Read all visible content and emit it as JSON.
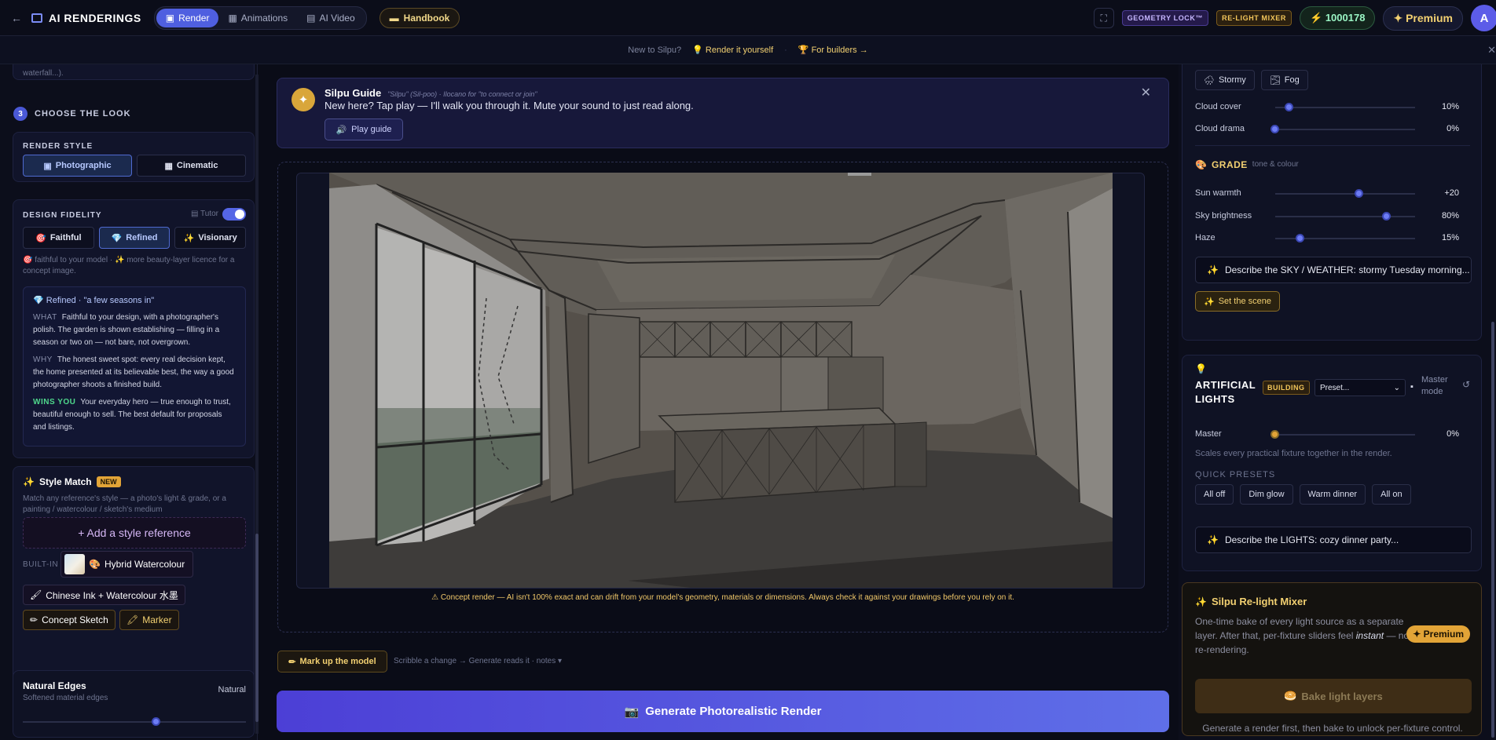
{
  "topbar": {
    "back_icon": "←",
    "title": "AI RENDERINGS",
    "modes": [
      {
        "label": "Render",
        "icon": "▣",
        "active": true
      },
      {
        "label": "Animations",
        "icon": "▦",
        "active": false
      },
      {
        "label": "AI Video",
        "icon": "▤",
        "active": false
      }
    ],
    "handbook": "Handbook",
    "expand_icon": "⛶",
    "geometry_lock": "GEOMETRY LOCK™",
    "relight_mixer": "RE-LIGHT MIXER",
    "credits": "1000178",
    "credits_icon": "⚡",
    "premium": "Premium",
    "premium_icon": "✦",
    "avatar": "A"
  },
  "subbar": {
    "new_to": "New to Silpu?",
    "render_it": "Render it yourself",
    "builders": "For builders →",
    "sep": "·",
    "close": "✕"
  },
  "left": {
    "truncated": "waterfall...).",
    "step_number": "3",
    "step_title": "CHOOSE THE LOOK",
    "render_style_label": "RENDER STYLE",
    "render_styles": [
      "Photographic",
      "Cinematic"
    ],
    "fidelity_label": "DESIGN FIDELITY",
    "tutor_label": "Tutor",
    "fidelity_options": [
      "Faithful",
      "Refined",
      "Visionary"
    ],
    "fidelity_hint_a": "faithful to your model ·",
    "fidelity_hint_b": "more beauty-layer licence for a concept image.",
    "info": {
      "title": "Refined · \"a few seasons in\"",
      "what_key": "WHAT",
      "what": "Faithful to your design, with a photographer's polish. The garden is shown establishing — filling in a season or two on — not bare, not overgrown.",
      "why_key": "WHY",
      "why": "The honest sweet spot: every real decision kept, the home presented at its believable best, the way a good photographer shoots a finished build.",
      "wins_key": "WINS YOU",
      "wins": "Your everyday hero — true enough to trust, beautiful enough to sell. The best default for proposals and listings."
    },
    "style_match": {
      "title": "Style Match",
      "badge": "NEW",
      "desc": "Match any reference's style — a photo's light & grade, or a painting / watercolour / sketch's medium",
      "add": "+ Add a style reference",
      "built_in": "BUILT-IN",
      "chips": [
        "Hybrid Watercolour",
        "Chinese Ink + Watercolour 水墨",
        "Concept Sketch",
        "Marker"
      ]
    },
    "natural_edges": {
      "title": "Natural Edges",
      "sub": "Softened material edges",
      "value": "Natural",
      "level": 0.6
    }
  },
  "guide": {
    "title": "Silpu Guide",
    "subtitle": "\"Silpu\" (Sil-poo) · Ilocano for \"to connect or join\"",
    "text": "New here? Tap play — I'll walk you through it. Mute your sound to just read along.",
    "play": "Play guide",
    "close": "✕"
  },
  "center": {
    "disclaimer": "⚠ Concept render — AI isn't 100% exact and can drift from your model's geometry, materials or dimensions. Always check it against your drawings before you rely on it.",
    "markup": "Mark up the model",
    "markup_hint": "Scribble a change → Generate reads it · notes ▾",
    "generate": "Generate Photorealistic Render"
  },
  "right": {
    "weather_chips": [
      "Stormy",
      "Fog"
    ],
    "cloud_cover": {
      "label": "Cloud cover",
      "value": "10%",
      "level": 0.1
    },
    "cloud_drama": {
      "label": "Cloud drama",
      "value": "0%",
      "level": 0.0
    },
    "grade_title": "GRADE",
    "grade_sub": "tone & colour",
    "sun_warmth": {
      "label": "Sun warmth",
      "value": "+20",
      "level": 0.6
    },
    "sky_brightness": {
      "label": "Sky brightness",
      "value": "80%",
      "level": 0.8
    },
    "haze": {
      "label": "Haze",
      "value": "15%",
      "level": 0.18
    },
    "sky_input": "Describe the SKY / WEATHER: stormy Tuesday morning... (",
    "set_scene": "Set the scene",
    "lights_title": "ARTIFICIAL LIGHTS",
    "building_badge": "BUILDING",
    "preset": "Preset...",
    "master_mode": "Master mode",
    "master": {
      "label": "Master",
      "value": "0%",
      "level": 0.0
    },
    "master_hint": "Scales every practical fixture together in the render.",
    "quick_presets_label": "QUICK PRESETS",
    "quick_presets": [
      "All off",
      "Dim glow",
      "Warm dinner",
      "All on"
    ],
    "lights_input": "Describe the LIGHTS: cozy dinner party...",
    "mixer": {
      "title": "Silpu Re-light Mixer",
      "desc_a": "One-time bake of every light source as a separate layer. After that, per-fixture sliders feel",
      "desc_em": "instant",
      "desc_b": "— no re-rendering.",
      "premium": "✦ Premium",
      "bake": "Bake light layers",
      "hint": "Generate a render first, then bake to unlock per-fixture control."
    }
  }
}
